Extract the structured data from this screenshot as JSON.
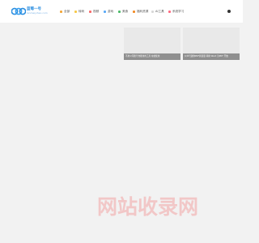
{
  "header": {
    "logo": {
      "title": "蓝莓一号",
      "subtitle": "lanmeiyihao.com"
    },
    "nav": [
      {
        "label": "全部",
        "icon": "home-icon",
        "color": "#f3a73b"
      },
      {
        "label": "转码",
        "icon": "code-icon",
        "color": "#f7c948"
      },
      {
        "label": "视频",
        "icon": "video-icon",
        "color": "#f76b6b"
      },
      {
        "label": "游戏",
        "icon": "game-icon",
        "color": "#5aa9f7"
      },
      {
        "label": "美食",
        "icon": "food-icon",
        "color": "#4dbb6a"
      },
      {
        "label": "福利资源",
        "icon": "gift-icon",
        "color": "#f28c28"
      },
      {
        "label": "AI工具",
        "icon": "ai-icon",
        "color": "#d8d8d8"
      },
      {
        "label": "系统学习",
        "icon": "book-icon",
        "color": "#ff6b81"
      }
    ]
  },
  "cards": [
    {
      "caption": "不用公司账号也能用的工具 在线使用"
    },
    {
      "caption": "公众号迷你PDF阅读量 转换 Word 为PDF 开放"
    }
  ],
  "watermark": {
    "text": "网站收录网"
  }
}
